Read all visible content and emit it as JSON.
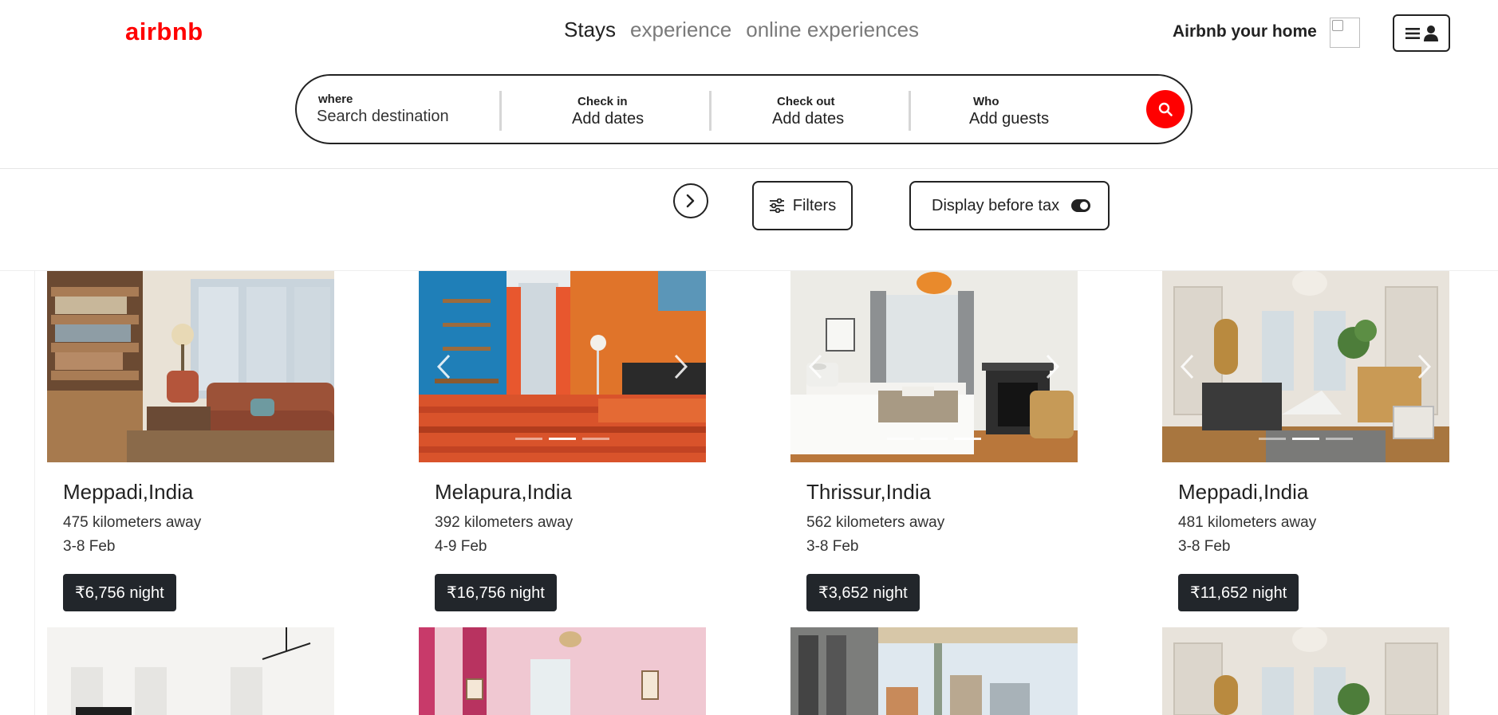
{
  "header": {
    "logo": "airbnb",
    "nav": [
      "Stays",
      "experience",
      "online experiences"
    ],
    "host_link": "Airbnb your home"
  },
  "search": {
    "where_label": "where",
    "where_placeholder": "Search destination",
    "checkin_label": "Check in",
    "checkin_value": "Add dates",
    "checkout_label": "Check out",
    "checkout_value": "Add dates",
    "who_label": "Who",
    "who_value": "Add guests"
  },
  "filters": {
    "filters_label": "Filters",
    "tax_label": "Display before tax"
  },
  "colors": {
    "brand": "#ff0000",
    "price_bg": "#22262b"
  },
  "listings": [
    {
      "title": "Meppadi,India",
      "distance": "475 kilometers away",
      "dates": "3-8 Feb",
      "price": "₹6,756 night"
    },
    {
      "title": "Melapura,India",
      "distance": "392 kilometers away",
      "dates": "4-9 Feb",
      "price": "₹16,756 night"
    },
    {
      "title": "Thrissur,India",
      "distance": "562 kilometers away",
      "dates": "3-8 Feb",
      "price": "₹3,652 night"
    },
    {
      "title": "Meppadi,India",
      "distance": "481 kilometers away",
      "dates": "3-8 Feb",
      "price": "₹11,652 night"
    }
  ]
}
